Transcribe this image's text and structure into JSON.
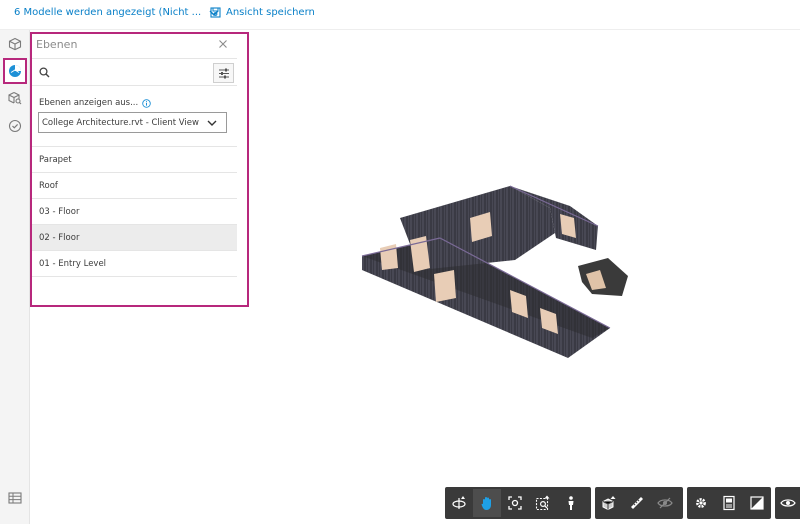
{
  "topbar": {
    "models_label": "6 Modelle werden angezeigt (Nicht ...",
    "save_view_label": "Ansicht speichern"
  },
  "rail": {
    "items": [
      "model-browser-icon",
      "levels-icon",
      "search-model-icon",
      "issues-icon",
      "table-icon"
    ],
    "active": "levels-icon"
  },
  "panel": {
    "title": "Ebenen",
    "search_value": "",
    "source_label": "Ebenen anzeigen aus...",
    "source_value": "College Architecture.rvt - Client View",
    "levels": [
      {
        "label": "Parapet",
        "selected": false
      },
      {
        "label": "Roof",
        "selected": false
      },
      {
        "label": "03 - Floor",
        "selected": false
      },
      {
        "label": "02 - Floor",
        "selected": true
      },
      {
        "label": "01 - Entry Level",
        "selected": false
      }
    ]
  },
  "toolbar": {
    "groups": [
      [
        "orbit-icon",
        "pan-icon",
        "fit-to-view-icon",
        "zoom-window-icon",
        "first-person-icon"
      ],
      [
        "section-box-icon",
        "measure-icon",
        "visibility-icon"
      ],
      [
        "settings-icon",
        "properties-icon",
        "fullscreen-icon"
      ],
      [
        "eye-icon"
      ]
    ],
    "active": "pan-icon"
  },
  "colors": {
    "accent_blue": "#0a80c8",
    "highlight_magenta": "#b7287c",
    "toolbar_bg": "#3a3a3a",
    "pan_active_blue": "#1ea0e6"
  }
}
